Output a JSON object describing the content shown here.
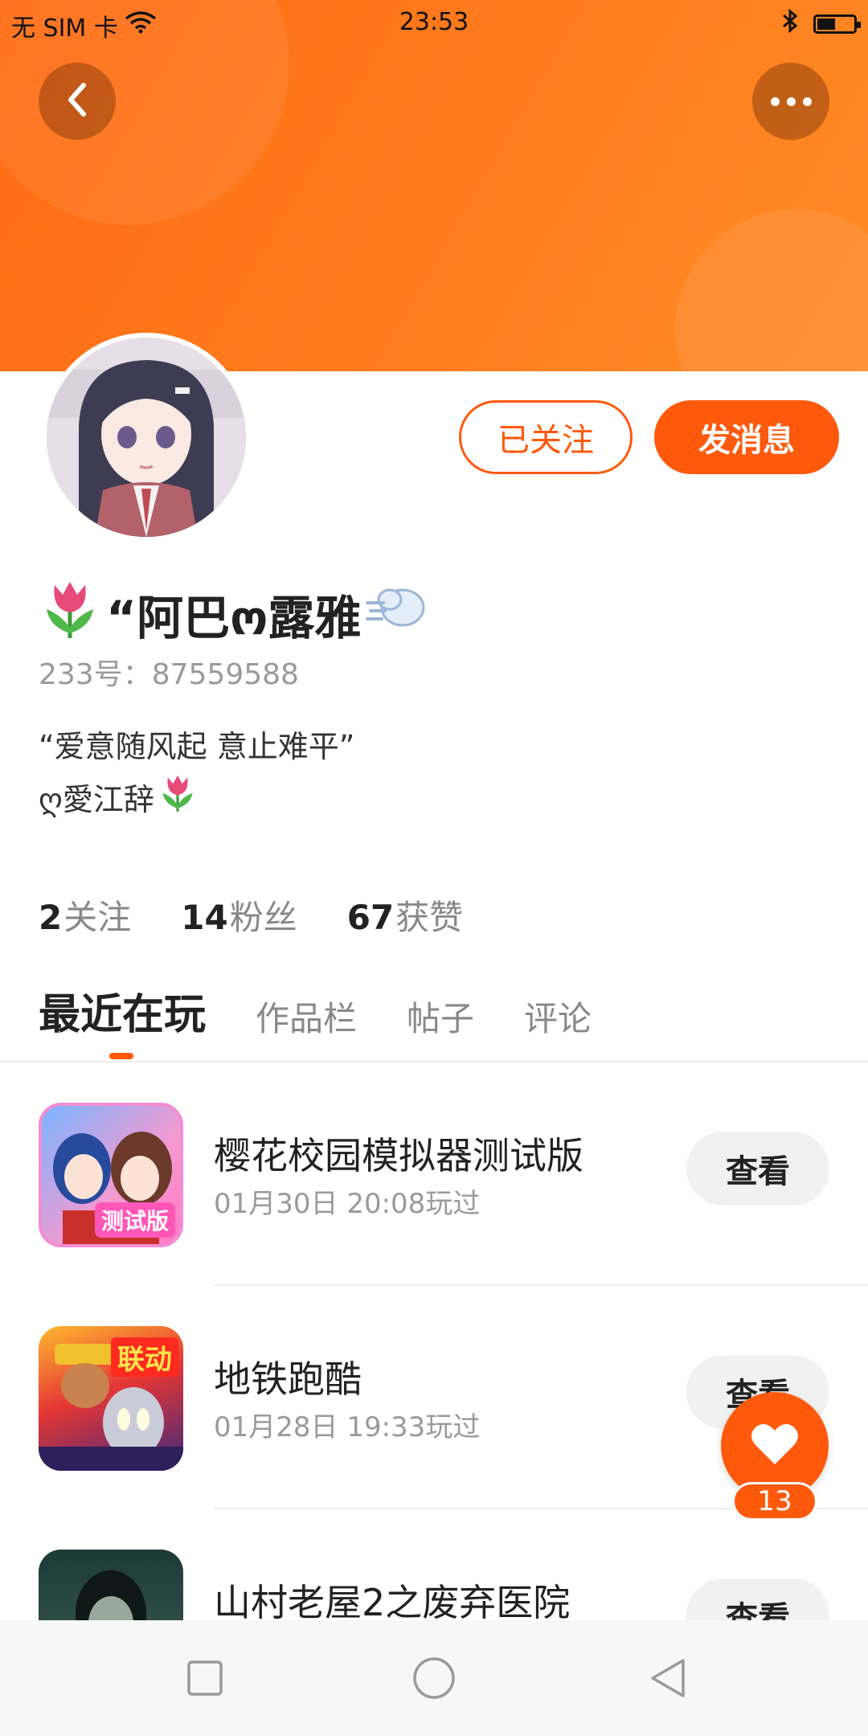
{
  "status_bar": {
    "carrier": "无 SIM 卡",
    "time": "23:53",
    "battery_level": 0.45
  },
  "header": {
    "back_icon": "chevron-left-icon",
    "more_icon": "more-dots-icon",
    "accent_color": "#ff5a0c"
  },
  "profile": {
    "nickname": "“阿巴ო露雅",
    "id_line": "233号：87559588",
    "bio_line1": "“爱意随风起 意止难平”",
    "bio_line2": "ღ愛江辞",
    "follow_button": "已关注",
    "message_button": "发消息",
    "stats": [
      {
        "count": "2",
        "label": "关注"
      },
      {
        "count": "14",
        "label": "粉丝"
      },
      {
        "count": "67",
        "label": "获赞"
      }
    ]
  },
  "tabs": [
    {
      "label": "最近在玩",
      "active": true
    },
    {
      "label": "作品栏",
      "active": false
    },
    {
      "label": "帖子",
      "active": false
    },
    {
      "label": "评论",
      "active": false
    }
  ],
  "games": [
    {
      "title": "樱花校园模拟器测试版",
      "time": "01月30日 20:08玩过",
      "button": "查看",
      "icon_tag": "测试版"
    },
    {
      "title": "地铁跑酷",
      "time": "01月28日 19:33玩过",
      "button": "查看",
      "icon_tag": "联动"
    },
    {
      "title": "山村老屋2之废弃医院",
      "time": "",
      "button": "查看",
      "icon_tag": ""
    }
  ],
  "like_fab": {
    "count": "13",
    "icon": "heart-icon"
  },
  "nav": {
    "recent_icon": "square-icon",
    "home_icon": "circle-icon",
    "back_icon": "triangle-back-icon"
  }
}
